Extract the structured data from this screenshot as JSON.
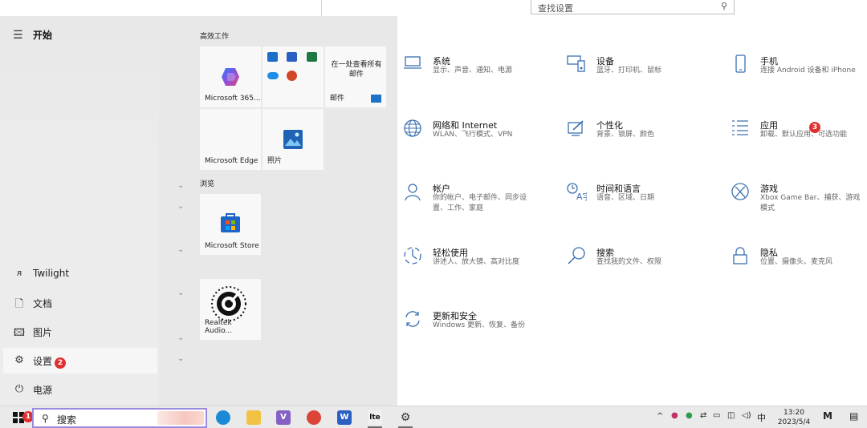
{
  "settings": {
    "search_placeholder": "查找设置",
    "tiles": [
      {
        "title": "系统",
        "desc": "显示、声音、通知、电源",
        "icon": "laptop-icon"
      },
      {
        "title": "设备",
        "desc": "蓝牙、打印机、鼠标",
        "icon": "devices-icon"
      },
      {
        "title": "手机",
        "desc": "连接 Android 设备和 iPhone",
        "icon": "phone-icon"
      },
      {
        "title": "网络和 Internet",
        "desc": "WLAN、飞行模式、VPN",
        "icon": "globe-icon"
      },
      {
        "title": "个性化",
        "desc": "背景、锁屏、颜色",
        "icon": "personalize-icon"
      },
      {
        "title": "应用",
        "desc": "卸载、默认应用、可选功能",
        "icon": "apps-icon"
      },
      {
        "title": "帐户",
        "desc": "你的帐户、电子邮件、同步设置、工作、家庭",
        "icon": "account-icon"
      },
      {
        "title": "时间和语言",
        "desc": "语音、区域、日期",
        "icon": "time-language-icon"
      },
      {
        "title": "游戏",
        "desc": "Xbox Game Bar、捕获、游戏模式",
        "icon": "xbox-icon"
      },
      {
        "title": "轻松使用",
        "desc": "讲述人、放大镜、高对比度",
        "icon": "ease-of-access-icon"
      },
      {
        "title": "搜索",
        "desc": "查找我的文件、权限",
        "icon": "search-icon"
      },
      {
        "title": "隐私",
        "desc": "位置、摄像头、麦克风",
        "icon": "lock-icon"
      },
      {
        "title": "更新和安全",
        "desc": "Windows 更新、恢复、备份",
        "icon": "update-icon"
      }
    ]
  },
  "start_menu": {
    "title": "开始",
    "user": "Twilight",
    "items": {
      "documents": "文档",
      "pictures": "图片",
      "settings": "设置",
      "power": "电源"
    },
    "groups": {
      "productivity": "高效工作",
      "browse": "浏览"
    },
    "tiles": {
      "m365": "Microsoft 365...",
      "mail_heading": "在一处查看所有邮件",
      "mail": "邮件",
      "edge": "Microsoft Edge",
      "photos": "照片",
      "store": "Microsoft Store",
      "realtek": "Realtek Audio..."
    }
  },
  "badges": {
    "one": "1",
    "two": "2",
    "three": "3"
  },
  "taskbar": {
    "search_label": "搜索",
    "tray_lang": "中",
    "time": "13:20",
    "date": "2023/5/4",
    "colors": {
      "search_border": "#9b8be0",
      "badge": "#e03030"
    }
  }
}
